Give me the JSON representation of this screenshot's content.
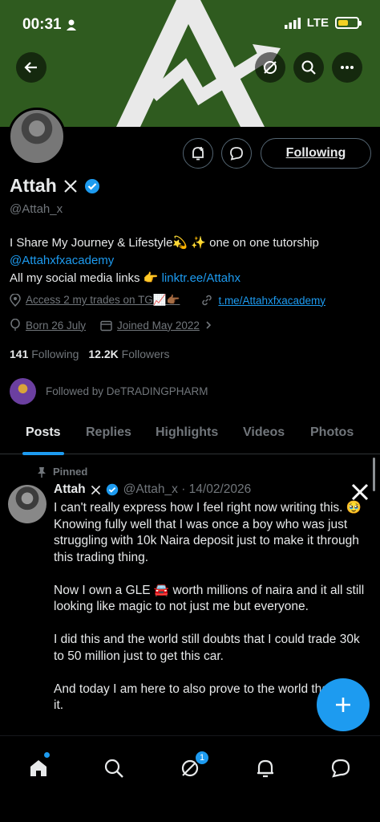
{
  "status_bar": {
    "time": "00:31",
    "network": "LTE"
  },
  "profile": {
    "name": "Attah",
    "handle": "@Attah_x",
    "following_button": "Following",
    "bio_line1": "I Share My Journey & Lifestyle💫 ✨  one on one tutorship",
    "bio_mention": "@Attahxfxacademy",
    "bio_line3_prefix": "All my social media links 👉 ",
    "bio_link": "linktr.ee/Attahx",
    "meta_text1": "Access 2 my trades on TG📈👉🏾",
    "meta_link": "t.me/Attahxfxacademy",
    "born": "Born 26 July",
    "joined": "Joined May 2022",
    "following_count": "141",
    "following_label": "Following",
    "followers_count": "12.2K",
    "followers_label": "Followers",
    "followed_by": "Followed by DeTRADINGPHARM"
  },
  "tabs": [
    "Posts",
    "Replies",
    "Highlights",
    "Videos",
    "Photos"
  ],
  "post": {
    "pinned_label": "Pinned",
    "author": "Attah",
    "handle_date": "@Attah_x · 14/02/2026",
    "p1": "I can't really express how I feel right now writing this. 🥹",
    "p2": "Knowing fully well that I was once a boy who was just struggling with 10k Naira deposit just to make it through this trading thing.",
    "p3": "Now I own a GLE 🚘 worth millions of naira and it all still looking like magic to not just me but everyone.",
    "p4": "I did this and the world still doubts that I could trade 30k to 50 million just to get this car.",
    "p5": "And today I am here to also prove to the world that I did it."
  },
  "nav": {
    "messages_badge": "1"
  },
  "icons": [
    "back-icon",
    "grok-icon",
    "search-icon",
    "more-icon",
    "notify-icon",
    "message-icon",
    "verified-icon",
    "x-icon",
    "location-icon",
    "link-icon",
    "balloon-icon",
    "calendar-icon",
    "pin-icon",
    "plus-icon",
    "home-icon",
    "communities-icon",
    "bell-icon",
    "chat-icon"
  ],
  "colors": {
    "accent": "#1d9bf0",
    "banner": "#2f5b1f",
    "background": "#000000"
  }
}
